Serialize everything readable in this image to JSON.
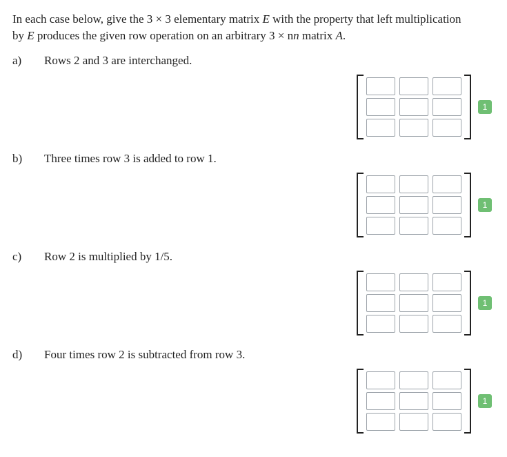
{
  "intro": {
    "line1_pre": "In each case below, give the  ",
    "dim": "3 × 3",
    "line1_mid": "  elementary matrix  ",
    "E": "E",
    "line1_post": "  with the property that left multiplication",
    "line2_pre": "by  ",
    "E2": "E",
    "line2_mid": "  produces the given row operation on an arbitrary  ",
    "dim2": "3 × n",
    "line2_mid2": "  matrix  ",
    "A": "A",
    "line2_end": "."
  },
  "parts": {
    "a": {
      "label": "a)",
      "text": "Rows 2 and 3 are interchanged.",
      "points": "1"
    },
    "b": {
      "label": "b)",
      "text": "Three times row 3 is added to row 1.",
      "points": "1"
    },
    "c": {
      "label": "c)",
      "text": "Row 2 is multiplied by 1/5.",
      "points": "1"
    },
    "d": {
      "label": "d)",
      "text": "Four times row 2 is subtracted from row 3.",
      "points": "1"
    }
  },
  "matrix": {
    "rows": 3,
    "cols": 3,
    "values": [
      [
        "",
        "",
        ""
      ],
      [
        "",
        "",
        ""
      ],
      [
        "",
        "",
        ""
      ]
    ]
  }
}
